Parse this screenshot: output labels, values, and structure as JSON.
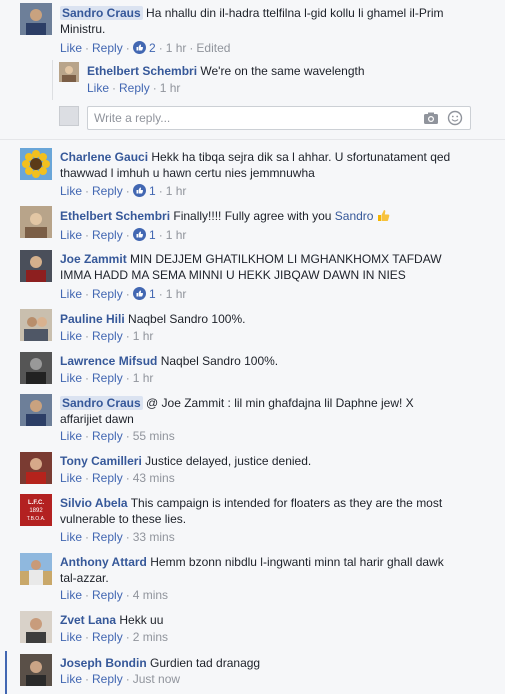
{
  "actions": {
    "like": "Like",
    "reply": "Reply",
    "sep": "·"
  },
  "comments": [
    {
      "name": "Sandro Craus",
      "text": "Ha nhallu din il-hadra ttelfilna l-gid kollu li ghamel il-Prim Ministru.",
      "likes": "2",
      "time": "1 hr",
      "extra": "Edited"
    },
    {
      "name": "Ethelbert Schembri",
      "text": "We're on the same wavelength",
      "time": "1 hr"
    },
    {
      "name": "Charlene Gauci",
      "text": "Hekk ha tibqa sejra dik sa l ahhar. U sfortunatament qed thawwad l imhuh u hawn certu nies jemmnuwha",
      "likes": "1",
      "time": "1 hr"
    },
    {
      "name": "Ethelbert Schembri",
      "text": "Finally!!!! Fully agree with you",
      "mention": "Sandro",
      "likes": "1",
      "time": "1 hr"
    },
    {
      "name": "Joe Zammit",
      "text": "MIN DEJJEM GHATILKHOM LI MGHANKHOMX TAFDAW IMMA HADD MA SEMA MINNI U HEKK JIBQAW DAWN IN NIES",
      "likes": "1",
      "time": "1 hr"
    },
    {
      "name": "Pauline Hili",
      "text": "Naqbel Sandro 100%.",
      "time": "1 hr"
    },
    {
      "name": "Lawrence Mifsud",
      "text": "Naqbel Sandro 100%.",
      "time": "1 hr"
    },
    {
      "name": "Sandro Craus",
      "text": "@ Joe Zammit : lil min ghafdajna lil Daphne jew! X affarijiet dawn",
      "time": "55 mins"
    },
    {
      "name": "Tony Camilleri",
      "text": "Justice delayed, justice denied.",
      "time": "43 mins"
    },
    {
      "name": "Silvio Abela",
      "text": "This campaign is intended for floaters as they are the most vulnerable to these lies.",
      "time": "33 mins",
      "avatar_text": "L.F.C. 1892 T.B.O.A."
    },
    {
      "name": "Anthony Attard",
      "text": "Hemm bzonn nibdlu l-ingwanti minn tal harir ghall dawk tal-azzar.",
      "time": "4 mins"
    },
    {
      "name": "Zvet Lana",
      "text": "Hekk uu",
      "time": "2 mins"
    },
    {
      "name": "Joseph Bondin",
      "text": "Gurdien tad dranagg",
      "time": "Just now"
    }
  ],
  "reply_box": {
    "placeholder": "Write a reply..."
  },
  "icons": {
    "like": "like-thumb-icon",
    "camera": "camera-icon",
    "emoji": "smiley-icon",
    "thumbs": "thumbs-up-emoji-icon"
  },
  "colors": {
    "link": "#365899",
    "action": "#4267b2",
    "meta": "#90949c",
    "bg": "#f6f7f9"
  }
}
